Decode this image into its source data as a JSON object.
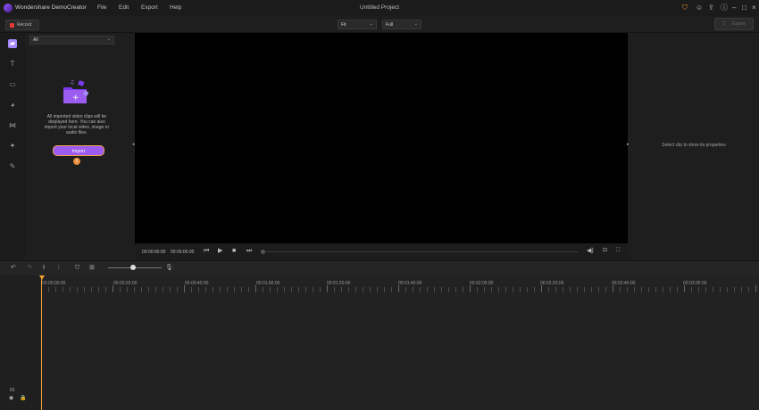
{
  "app": {
    "title": "Wondershare DemoCreator",
    "project_title": "Untitled Project"
  },
  "menu": [
    "File",
    "Edit",
    "Export",
    "Help"
  ],
  "window_icons": [
    "cart-icon",
    "person-icon",
    "upload-icon",
    "info-icon",
    "minimize-icon",
    "maximize-icon",
    "close-icon"
  ],
  "toolbar": {
    "record_label": "Record",
    "fit_value": "Fit",
    "quality_value": "Full",
    "export_label": "Export"
  },
  "sidebar": {
    "items": [
      "media-icon",
      "text-icon",
      "caption-icon",
      "sticker-icon",
      "transition-icon",
      "effect-icon",
      "pin-icon"
    ]
  },
  "media": {
    "filter": "All",
    "empty_text": "All imported video clips will be displayed here. You can also import your local video, image or audio files.",
    "import_label": "Import",
    "badge": "1"
  },
  "player": {
    "current_time": "00:00:00:00",
    "total_time": "00:00:00:00"
  },
  "properties": {
    "hint": "Select clip to show its properties"
  },
  "timeline": {
    "ruler": [
      "00:00:00:00",
      "00:00:20:00",
      "00:00:40:00",
      "00:01:00:00",
      "00:01:20:00",
      "00:01:40:00",
      "00:02:00:00",
      "00:02:20:00",
      "00:02:40:00",
      "00:03:00:00"
    ],
    "track_number": "01",
    "zoom_level": 0.47
  },
  "colors": {
    "accent": "#9d5cf0",
    "playhead": "#f0a030",
    "record": "#e53935"
  }
}
